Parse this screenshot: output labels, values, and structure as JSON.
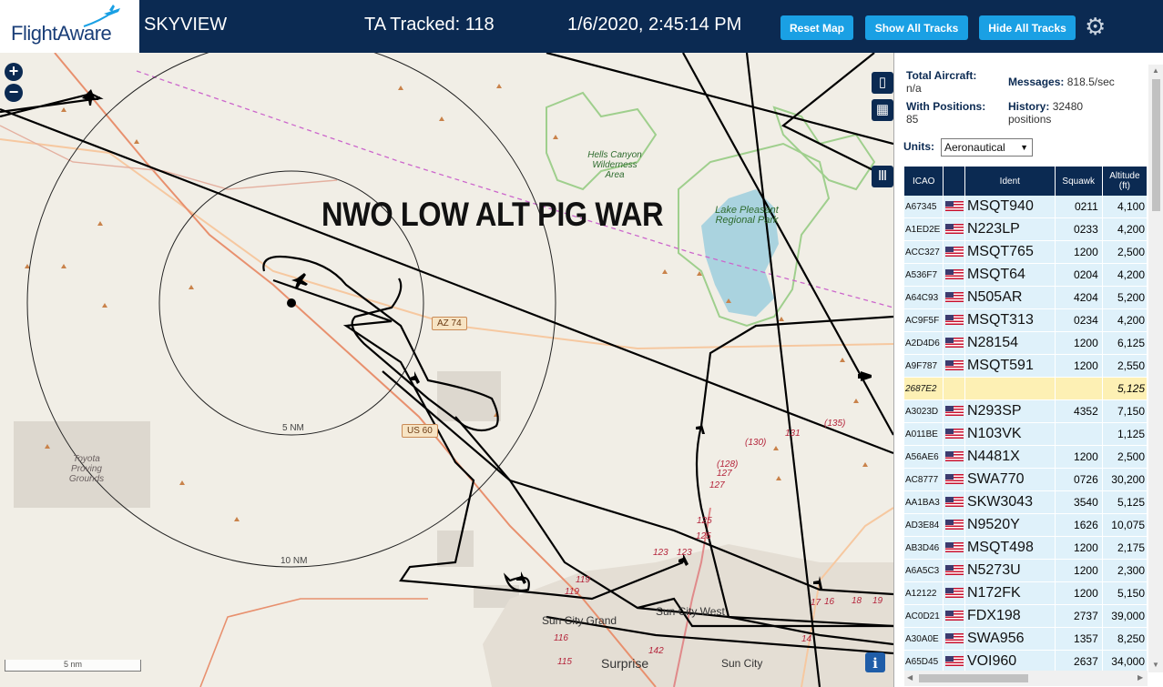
{
  "header": {
    "logo_text": "FlightAware",
    "app_title": "SKYVIEW",
    "ta_tracked": "TA Tracked: 118",
    "clock": "1/6/2020, 2:45:14 PM",
    "buttons": {
      "reset": "Reset Map",
      "show": "Show All Tracks",
      "hide": "Hide All Tracks"
    },
    "settings_icon": "gear-icon"
  },
  "map": {
    "overlay_title": "NWO LOW ALT PIG WAR",
    "range_rings": [
      "5 NM",
      "10 NM"
    ],
    "scale_label": "5 nm",
    "roads": [
      "AZ 74",
      "US 60"
    ],
    "places": [
      "Hells Canyon Wilderness Area",
      "Lake Pleasant Regional Park",
      "Toyota Proving Grounds",
      "Sun City Grand",
      "Sun City West",
      "Surprise",
      "Sun City"
    ],
    "route_numbers": [
      "(135)",
      "131",
      "(130)",
      "(128)",
      "127",
      "127",
      "125",
      "125",
      "123",
      "123",
      "119",
      "119",
      "116",
      "115",
      "142",
      "17",
      "16",
      "18",
      "19",
      "14"
    ],
    "controls": {
      "zoom_in": "+",
      "zoom_out": "−",
      "info": "i"
    }
  },
  "panel": {
    "stats": {
      "total_label": "Total Aircraft:",
      "total_value": "n/a",
      "positions_label": "With Positions:",
      "positions_value": "85",
      "messages_label": "Messages:",
      "messages_value": "818.5/sec",
      "history_label": "History:",
      "history_value": "32480",
      "history_unit": "positions"
    },
    "units_label": "Units:",
    "units_value": "Aeronautical",
    "columns": {
      "icao": "ICAO",
      "ident": "Ident",
      "squawk": "Squawk",
      "altitude": "Altitude (ft)"
    },
    "rows": [
      {
        "icao": "A67345",
        "ident": "MSQT940",
        "squawk": "0211",
        "alt": "4,100"
      },
      {
        "icao": "A1ED2E",
        "ident": "N223LP",
        "squawk": "0233",
        "alt": "4,200"
      },
      {
        "icao": "ACC327",
        "ident": "MSQT765",
        "squawk": "1200",
        "alt": "2,500"
      },
      {
        "icao": "A536F7",
        "ident": "MSQT64",
        "squawk": "0204",
        "alt": "4,200"
      },
      {
        "icao": "A64C93",
        "ident": "N505AR",
        "squawk": "4204",
        "alt": "5,200"
      },
      {
        "icao": "AC9F5F",
        "ident": "MSQT313",
        "squawk": "0234",
        "alt": "4,200"
      },
      {
        "icao": "A2D4D6",
        "ident": "N28154",
        "squawk": "1200",
        "alt": "6,125"
      },
      {
        "icao": "A9F787",
        "ident": "MSQT591",
        "squawk": "1200",
        "alt": "2,550"
      },
      {
        "icao": "2687E2",
        "ident": "",
        "squawk": "",
        "alt": "5,125",
        "selected": true
      },
      {
        "icao": "A3023D",
        "ident": "N293SP",
        "squawk": "4352",
        "alt": "7,150"
      },
      {
        "icao": "A011BE",
        "ident": "N103VK",
        "squawk": "",
        "alt": "1,125"
      },
      {
        "icao": "A56AE6",
        "ident": "N4481X",
        "squawk": "1200",
        "alt": "2,500"
      },
      {
        "icao": "AC8777",
        "ident": "SWA770",
        "squawk": "0726",
        "alt": "30,200"
      },
      {
        "icao": "AA1BA3",
        "ident": "SKW3043",
        "squawk": "3540",
        "alt": "5,125"
      },
      {
        "icao": "AD3E84",
        "ident": "N9520Y",
        "squawk": "1626",
        "alt": "10,075"
      },
      {
        "icao": "AB3D46",
        "ident": "MSQT498",
        "squawk": "1200",
        "alt": "2,175"
      },
      {
        "icao": "A6A5C3",
        "ident": "N5273U",
        "squawk": "1200",
        "alt": "2,300"
      },
      {
        "icao": "A12122",
        "ident": "N172FK",
        "squawk": "1200",
        "alt": "5,150"
      },
      {
        "icao": "AC0D21",
        "ident": "FDX198",
        "squawk": "2737",
        "alt": "39,000"
      },
      {
        "icao": "A30A0E",
        "ident": "SWA956",
        "squawk": "1357",
        "alt": "8,250"
      },
      {
        "icao": "A65D45",
        "ident": "VOI960",
        "squawk": "2637",
        "alt": "34,000"
      }
    ]
  }
}
